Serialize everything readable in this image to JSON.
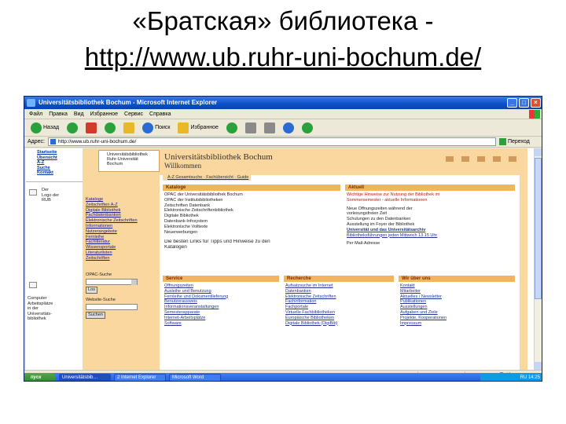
{
  "slide": {
    "title": "«Братская» библиотека -",
    "url": "http://www.ub.ruhr-uni-bochum.de/"
  },
  "browser": {
    "window_title": "Universitätsbibliothek Bochum - Microsoft Internet Explorer",
    "menu": [
      "Файл",
      "Правка",
      "Вид",
      "Избранное",
      "Сервис",
      "Справка"
    ],
    "toolbar": {
      "back": "Назад",
      "search": "Поиск",
      "favorites": "Избранное"
    },
    "address_label": "Адрес:",
    "address_value": "http://www.ub.ruhr-uni-bochum.de/",
    "go_label": "Переход",
    "status_zone": "Интернет"
  },
  "page": {
    "left_nav_top": [
      "Startseite",
      "Übersicht",
      "A-Z",
      "Suche",
      "Kontakt"
    ],
    "left_nav_lang": [
      "Der",
      "Logo der",
      "RUB"
    ],
    "left_nav_bottom": [
      "Computer",
      "Arbeitsplätze",
      "in der",
      "Universitäts-",
      "bibliothek"
    ],
    "logo_head": [
      "Universitätsbibliothek",
      "Ruhr-Universität",
      "Bochum"
    ],
    "header_title": "Universitätsbibliothek Bochum",
    "header_sub": "Willkommen",
    "breadcrumb": "A-Z Gesamtsuche · Fachübersicht · Guide",
    "catalog_links": [
      "Kataloge",
      "Zeitschriften A-Z",
      "Digitale Bibliothek",
      "Fachdatenbanken",
      "Elektronische Zeitschriften",
      "Informationen",
      "Nutzerangebote",
      "Fernleihe",
      "Fachliteratur",
      "Wissensportale",
      "Literaturlisten",
      "Zeitschriften"
    ],
    "side_box_1": {
      "label": "OPAC-Suche",
      "button": "Los"
    },
    "side_box_2": {
      "label": "Website-Suche",
      "button": "Suchen"
    },
    "panels": {
      "kataloge": {
        "title": "Kataloge",
        "lines": [
          "OPAC der Universitätsbibliothek Bochum",
          "OPAC der Institutsbibliotheken",
          "Zeitschriften Datenbank",
          "Elektronische Zeitschriftenbibliothek",
          "Digitale Bibliothek",
          "Datenbank-Infosystem",
          "Elektronische Volltexte",
          "Neuerwerbungen"
        ],
        "note": "Die besten Links für Tipps und Hinweise zu den",
        "note2": "Katalogen"
      },
      "aktuell": {
        "title": "Aktuell",
        "lines_red": [
          "Wichtige Hinweise zur Nutzung der Bibliothek im",
          "Sommersemester - aktuelle Informationen"
        ],
        "lines": [
          "Neue Öffnungszeiten während der",
          "vorlesungsfreien Zeit",
          "Schulungen zu den Datenbanken",
          "Ausstellung im Foyer der Bibliothek",
          "Universität und das Universitätsarchiv"
        ],
        "footer": "Bibliotheksführungen jeden Mittwoch 13.15 Uhr",
        "newsletter": "Per Mail-Adresse"
      },
      "service": {
        "title": "Service",
        "links": [
          "Öffnungszeiten",
          "Ausleihe und Benutzung",
          "Fernleihe und Dokumentlieferung",
          "Benutzerausweis",
          "Informationsveranstaltungen",
          "Semesterapparate",
          "Internet-Arbeitsplätze",
          "Software"
        ]
      },
      "recherche": {
        "title": "Recherche",
        "links": [
          "Aufsatzsuche im Internet",
          "Datenbanken",
          "Elektronische Zeitschriften",
          "Fachinformation",
          "Fachportale",
          "Virtuelle Fachbibliotheken",
          "Europäische Bibliotheken",
          "Digitale Bibliothek (DigiBib)"
        ]
      },
      "wir": {
        "title": "Wir über uns",
        "links": [
          "Kontakt",
          "Mitarbeiter",
          "Aktuelles / Newsletter",
          "Publikationen",
          "Ausstellungen",
          "Aufgaben und Ziele",
          "Projekte, Kooperationen",
          "Impressum"
        ]
      }
    }
  },
  "taskbar": {
    "start": "пуск",
    "tasks": [
      "Universitätsbib…",
      "2 Internet Explorer",
      "Microsoft Word"
    ],
    "clock": "RU 14:25"
  }
}
